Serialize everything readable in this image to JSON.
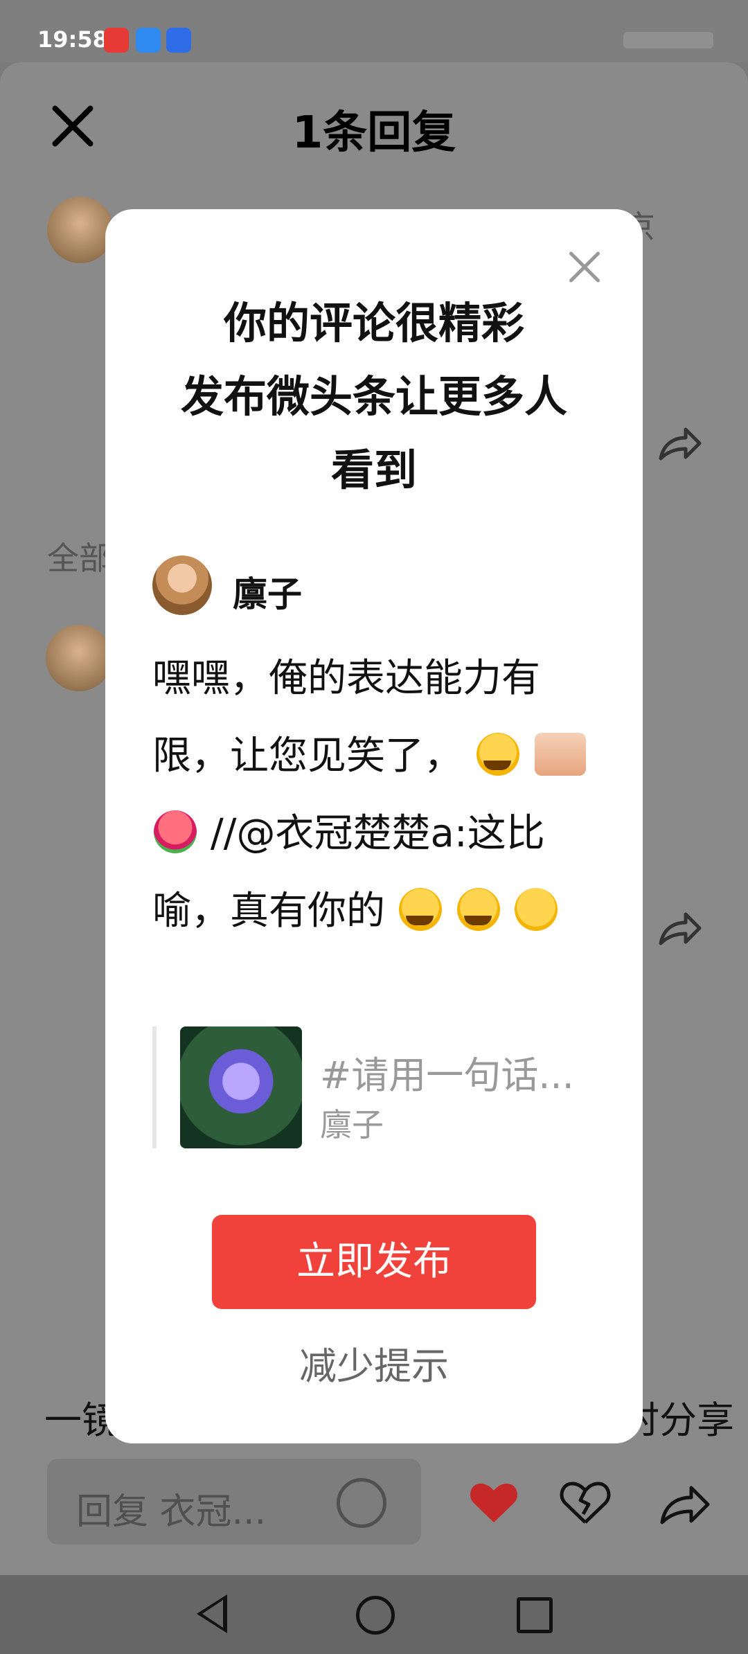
{
  "status": {
    "time": "19:58"
  },
  "sheet": {
    "title": "1条回复",
    "bg_fragments": {
      "section_label": "全部",
      "right_top": "京",
      "bottom_left": "一镜",
      "bottom_right": "时分享"
    }
  },
  "reply_bar": {
    "placeholder": "回复 衣冠..."
  },
  "modal": {
    "title_lines": [
      "你的评论很精彩",
      "发布微头条让更多人",
      "看到"
    ],
    "author_name": "廪子",
    "comment_text_1": "嘿嘿，俺的表达能力有限，让您见笑了，",
    "comment_text_2": "//@衣冠楚楚a:这比喻，真有你的",
    "quote": {
      "title": "#请用一句话...",
      "author": "廪子"
    },
    "publish_label": "立即发布",
    "reduce_label": "减少提示"
  },
  "icons": {
    "close": "close-icon",
    "share": "share-icon",
    "heart": "heart-icon",
    "broken_heart": "broken-heart-icon",
    "emoji": "emoji-icon",
    "nav_back": "back-icon",
    "nav_home": "home-icon",
    "nav_recent": "recent-apps-icon"
  },
  "colors": {
    "primary": "#f0413a",
    "overlay": "#7a7a7a"
  }
}
